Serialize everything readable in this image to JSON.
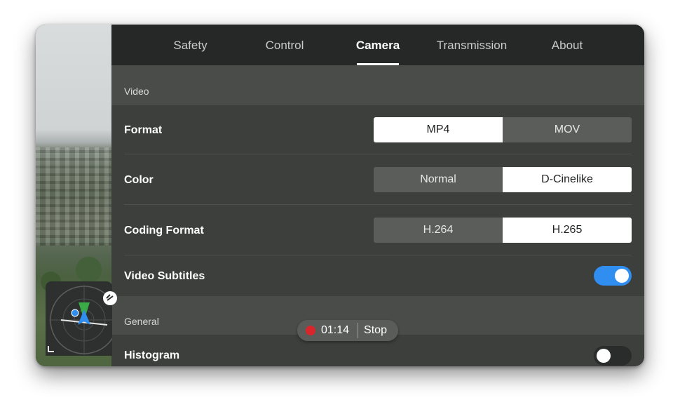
{
  "tabs": [
    {
      "label": "Safety",
      "active": false
    },
    {
      "label": "Control",
      "active": false
    },
    {
      "label": "Camera",
      "active": true
    },
    {
      "label": "Transmission",
      "active": false
    },
    {
      "label": "About",
      "active": false
    }
  ],
  "video_section": {
    "title": "Video",
    "format": {
      "label": "Format",
      "options": [
        "MP4",
        "MOV"
      ],
      "selected": "MP4"
    },
    "color": {
      "label": "Color",
      "options": [
        "Normal",
        "D-Cinelike"
      ],
      "selected": "D-Cinelike"
    },
    "coding_format": {
      "label": "Coding Format",
      "options": [
        "H.264",
        "H.265"
      ],
      "selected": "H.265"
    },
    "video_subtitles": {
      "label": "Video Subtitles",
      "enabled": true
    }
  },
  "general_section": {
    "title": "General",
    "histogram": {
      "label": "Histogram",
      "enabled": false
    }
  },
  "recording": {
    "time": "01:14",
    "stop_label": "Stop"
  },
  "radar": {
    "icon": "aircraft-radar-icon"
  },
  "colors": {
    "accent": "#2f8ef0",
    "record": "#d9262b",
    "tab_bar": "#262827",
    "panel": "#3d3f3d"
  }
}
